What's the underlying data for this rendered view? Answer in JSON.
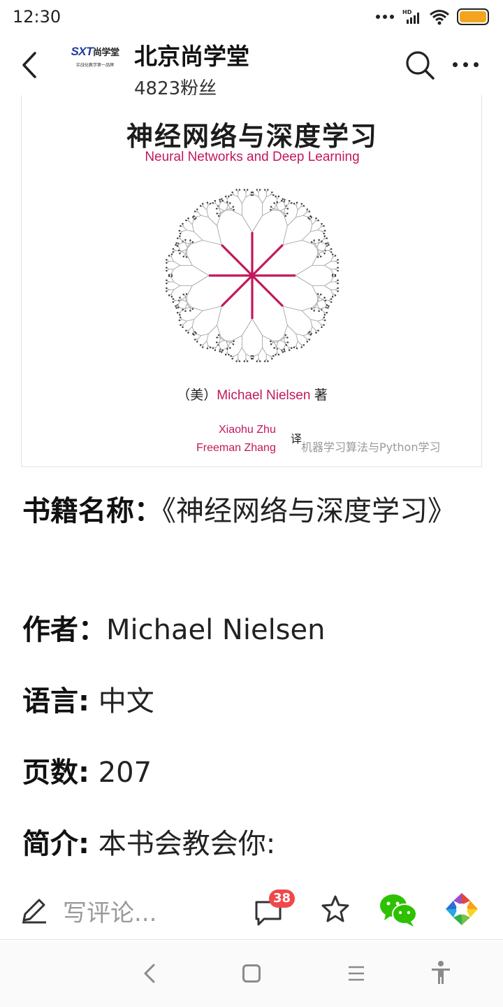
{
  "status_bar": {
    "time": "12:30",
    "network_label": "HD",
    "battery_color": "#f3a520"
  },
  "header": {
    "back_icon": "chevron-left-icon",
    "logo": {
      "brand": "SXT",
      "brand_cn": "尚学堂",
      "slogan": "实战化教学第一品牌"
    },
    "account_name": "北京尚学堂",
    "fans": "4823粉丝",
    "search_icon": "search-icon",
    "more_icon": "more-icon"
  },
  "book_cover": {
    "title": "神经网络与深度学习",
    "subtitle": "Neural Networks and Deep Learning",
    "author_prefix": "（美）",
    "author_name": "Michael Nielsen",
    "author_suffix": "著",
    "translator_1": "Xiaohu Zhu",
    "translator_2": "Freeman Zhang",
    "translate_mark": "译",
    "watermark": "机器学习算法与Python学习",
    "accent_color": "#c2185b"
  },
  "article": {
    "name_key": "书籍名称：",
    "name_value": "《神经网络与深度学习》",
    "author_key": "作者：",
    "author_value": "Michael Nielsen",
    "language_key": "语言:",
    "language_value": "中文",
    "pages_key": "页数:",
    "pages_value": "207",
    "intro_key": "简介:",
    "intro_value": "本书会教会你:"
  },
  "action_bar": {
    "comment_placeholder": "写评论...",
    "comment_count": "38",
    "icons": [
      "pen-icon",
      "comment-icon",
      "star-icon",
      "wechat-icon",
      "moments-icon"
    ],
    "badge_color": "#f0474a",
    "wechat_color": "#2dc100"
  },
  "system_nav": {
    "icons": [
      "back-icon",
      "home-icon",
      "recent-apps-icon",
      "accessibility-icon"
    ]
  }
}
